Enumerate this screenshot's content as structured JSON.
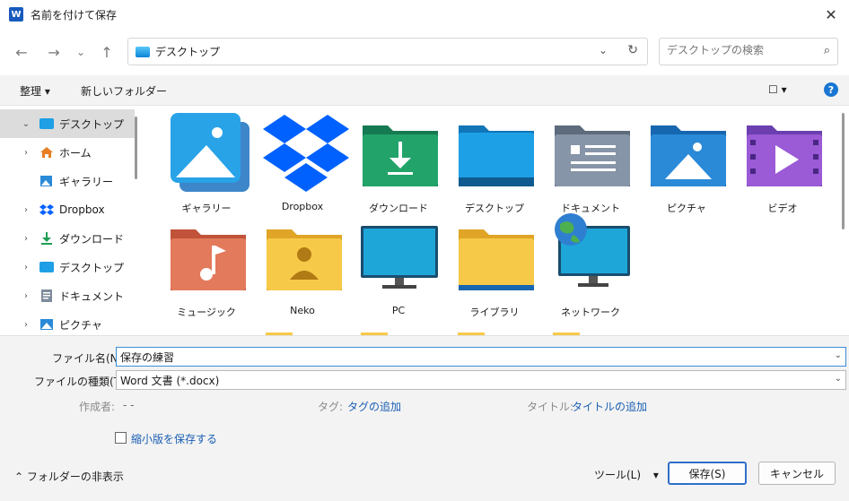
{
  "window": {
    "title": "名前を付けて保存",
    "app_icon": "W"
  },
  "nav": {
    "back": "←",
    "forward": "→",
    "recent": "⌄",
    "up": "↑"
  },
  "address": {
    "path": "デスクトップ",
    "chevron": "⌄",
    "refresh": "↻"
  },
  "search": {
    "placeholder": "デスクトップの検索"
  },
  "toolbar": {
    "organize": "整理 ▾",
    "new_folder": "新しいフォルダー",
    "view": "☐ ▾",
    "help": "?"
  },
  "sidebar": {
    "items": [
      {
        "label": "デスクトップ",
        "chevron": "⌄",
        "icon": "desktop-icon"
      },
      {
        "label": "ホーム",
        "chevron": "›",
        "icon": "home-icon"
      },
      {
        "label": "ギャラリー",
        "chevron": "",
        "icon": "gallery-icon"
      },
      {
        "label": "Dropbox",
        "chevron": "›",
        "icon": "dropbox-icon"
      },
      {
        "label": "ダウンロード",
        "chevron": "›",
        "icon": "download-icon"
      },
      {
        "label": "デスクトップ",
        "chevron": "›",
        "icon": "desktop-icon"
      },
      {
        "label": "ドキュメント",
        "chevron": "›",
        "icon": "document-icon"
      },
      {
        "label": "ピクチャ",
        "chevron": "›",
        "icon": "pictures-icon"
      }
    ]
  },
  "items": [
    {
      "label": "ギャラリー",
      "icon": "gallery-icon"
    },
    {
      "label": "Dropbox",
      "icon": "dropbox-icon"
    },
    {
      "label": "ダウンロード",
      "icon": "downloads-folder-icon"
    },
    {
      "label": "デスクトップ",
      "icon": "desktop-folder-icon"
    },
    {
      "label": "ドキュメント",
      "icon": "documents-folder-icon"
    },
    {
      "label": "ピクチャ",
      "icon": "pictures-folder-icon"
    },
    {
      "label": "ビデオ",
      "icon": "videos-folder-icon"
    },
    {
      "label": "ミュージック",
      "icon": "music-folder-icon"
    },
    {
      "label": "Neko",
      "icon": "user-folder-icon"
    },
    {
      "label": "PC",
      "icon": "pc-icon"
    },
    {
      "label": "ライブラリ",
      "icon": "library-folder-icon"
    },
    {
      "label": "ネットワーク",
      "icon": "network-icon"
    }
  ],
  "form": {
    "filename_label": "ファイル名(N):",
    "filename_value": "保存の練習",
    "filetype_label": "ファイルの種類(T):",
    "filetype_value": "Word 文書 (*.docx)",
    "author_label": "作成者:",
    "author_value": "- -",
    "tags_label": "タグ:",
    "tags_value": "タグの追加",
    "title_label": "タイトル:",
    "title_value": "タイトルの追加",
    "thumbnail_label": "縮小版を保存する",
    "hide_folders": "フォルダーの非表示",
    "tools": "ツール(L)",
    "save": "保存(S)",
    "cancel": "キャンセル"
  },
  "colors": {
    "accent": "#1a5fb4",
    "primary_border": "#2f6fc9",
    "help": "#1976d2"
  }
}
